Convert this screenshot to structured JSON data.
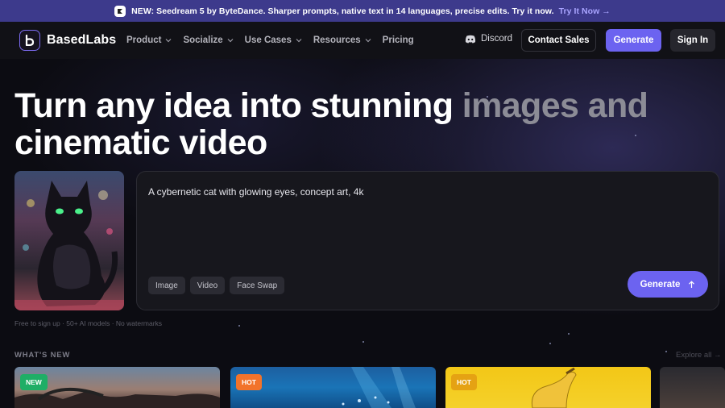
{
  "announcement": {
    "text": "NEW: Seedream 5 by ByteDance. Sharper prompts, native text in 14 languages, precise edits. Try it now.",
    "link": "Try It Now →"
  },
  "nav": {
    "logo": "BasedLabs",
    "items": [
      {
        "label": "Product",
        "dropdown": true
      },
      {
        "label": "Socialize",
        "dropdown": true
      },
      {
        "label": "Use Cases",
        "dropdown": true
      },
      {
        "label": "Resources",
        "dropdown": true
      },
      {
        "label": "Pricing",
        "dropdown": false
      }
    ],
    "discord": "Discord",
    "contact_sales": "Contact Sales",
    "generate": "Generate",
    "sign_in": "Sign In"
  },
  "hero": {
    "title_main": "Turn any idea into stunning ",
    "title_fade": "images and",
    "title_line2": "cinematic video"
  },
  "prompt": {
    "text": "A cybernetic cat with glowing eyes, concept art, 4k",
    "modes": [
      "Image",
      "Video",
      "Face Swap"
    ],
    "generate": "Generate",
    "note": "Free to sign up · 50+ AI models · No watermarks"
  },
  "whats_new": {
    "heading": "WHAT'S NEW",
    "explore": "Explore all →",
    "cards": [
      {
        "badge": "NEW"
      },
      {
        "badge": "HOT"
      },
      {
        "badge": "HOT"
      },
      {
        "badge": ""
      }
    ]
  },
  "colors": {
    "accent": "#6c63f0",
    "announce_bg": "#3d3a8c",
    "badge_new": "#1fae66",
    "badge_hot": "#f2732b"
  }
}
